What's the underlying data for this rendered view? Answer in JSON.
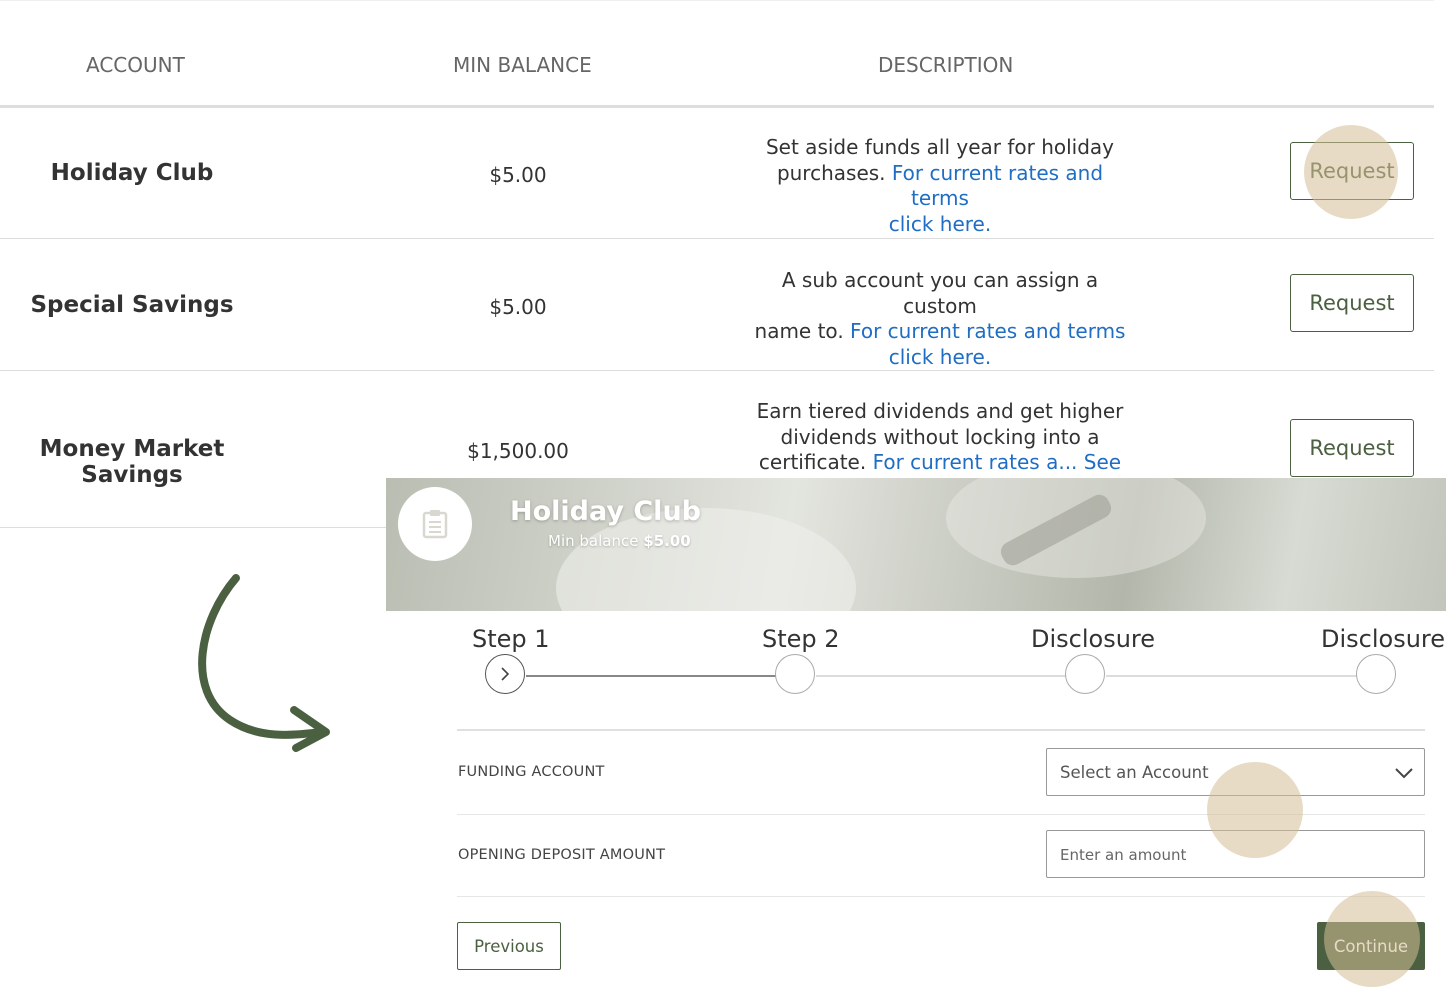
{
  "table": {
    "headers": {
      "account": "ACCOUNT",
      "min_balance": "MIN BALANCE",
      "description": "DESCRIPTION"
    },
    "rows": [
      {
        "name": "Holiday Club",
        "balance": "$5.00",
        "desc_lines": [
          "Set aside funds all year for holiday",
          "purchases."
        ],
        "link_inline": "For current rates and terms",
        "link_line2": "click here.",
        "action": "Request"
      },
      {
        "name": "Special Savings",
        "balance": "$5.00",
        "desc_lines": [
          "A sub account you can assign a custom",
          "name to."
        ],
        "link_inline": "For current rates and terms",
        "link_line2": "click here.",
        "action": "Request"
      },
      {
        "name": "Money Market Savings",
        "balance": "$1,500.00",
        "desc_lines": [
          "Earn tiered dividends and get higher",
          "dividends without locking into a",
          "certificate."
        ],
        "link_inline": "For current rates a... See",
        "action": "Request"
      }
    ]
  },
  "modal": {
    "title": "Holiday Club",
    "min_balance_label": "Min balance",
    "min_balance_value": "$5.00",
    "steps": [
      "Step 1",
      "Step 2",
      "Disclosure",
      "Disclosure"
    ],
    "fields": {
      "funding_label": "FUNDING ACCOUNT",
      "funding_value": "Select an Account",
      "deposit_label": "OPENING DEPOSIT AMOUNT",
      "deposit_placeholder": "Enter an amount"
    },
    "buttons": {
      "previous": "Previous",
      "continue": "Continue"
    }
  },
  "icons": {
    "logo": "clipboard-icon",
    "step_current": "chevron-right-icon",
    "dropdown": "chevron-down-icon",
    "annotation": "curved-arrow-icon"
  },
  "colors": {
    "accent": "#4b6041",
    "link": "#1f6ec4",
    "highlight": "#d6be96"
  }
}
